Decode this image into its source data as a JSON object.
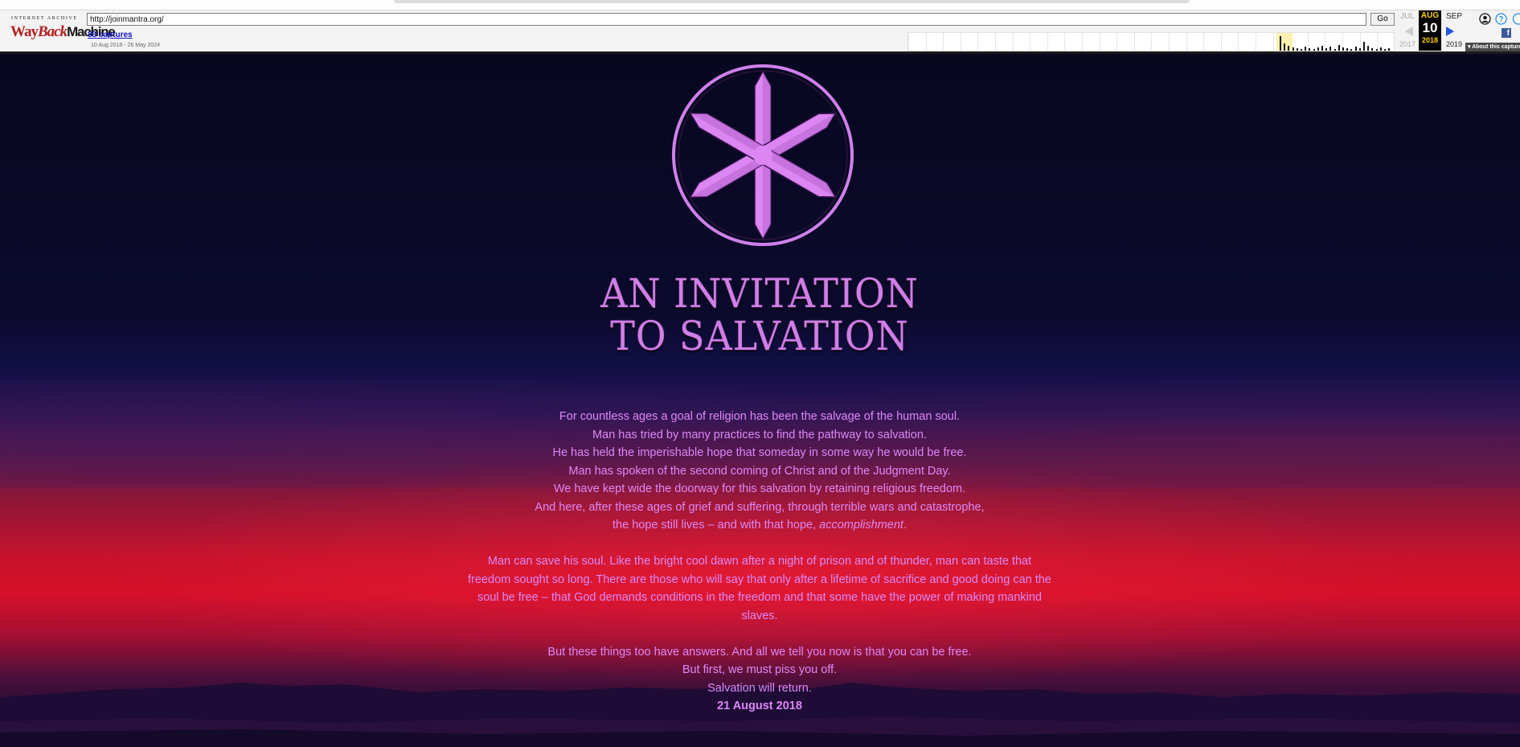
{
  "wayback": {
    "logo_small": "INTERNET ARCHIVE",
    "logo_way": "Way",
    "logo_back": "Back",
    "logo_machine": "Machine",
    "url": "http://joinmantra.org/",
    "go_label": "Go",
    "captures_label": "83 captures",
    "date_range": "10 Aug 2018 - 26 May 2024",
    "prev_month": "JUL",
    "current_month": "AUG",
    "next_month": "SEP",
    "current_day": "10",
    "prev_year": "2017",
    "current_year": "2018",
    "next_year": "2019",
    "about_label": "▾ About this capture",
    "highlight_color": "#ffd400",
    "user_icon": "user-circle-icon",
    "help_icon": "help-circle-icon",
    "facebook_icon": "facebook-icon",
    "facebook_letter": "f"
  },
  "page": {
    "title_line1": "AN INVITATION",
    "title_line2": "TO SALVATION",
    "emblem_icon": "six-pointed-star-emblem",
    "accent_color": "#dc88f6",
    "paragraph1": [
      "For countless ages a goal of religion has been the salvage of the human soul.",
      "Man has tried by many practices to find the pathway to salvation.",
      "He has held the imperishable hope that someday in some way he would be free.",
      "Man has spoken of the second coming of Christ and of the Judgment Day.",
      "We have kept wide the doorway for this salvation by retaining religious freedom.",
      "And here, after these ages of grief and suffering, through terrible wars and catastrophe,"
    ],
    "paragraph1_last_prefix": "the hope still lives – and with that hope, ",
    "paragraph1_last_emphasis": "accomplishment",
    "paragraph1_last_suffix": ".",
    "paragraph2": "Man can save his soul. Like the bright cool dawn after a night of prison and of thunder, man can taste that freedom sought so long. There are those who will say that only after a lifetime of sacrifice and good doing can the soul be free – that God demands conditions in the freedom and that some have the power of making mankind slaves.",
    "paragraph3": [
      "But these things too have answers. And all we tell you now is that you can be free.",
      "But first, we must piss you off.",
      "Salvation will return."
    ],
    "date": "21 August 2018"
  }
}
